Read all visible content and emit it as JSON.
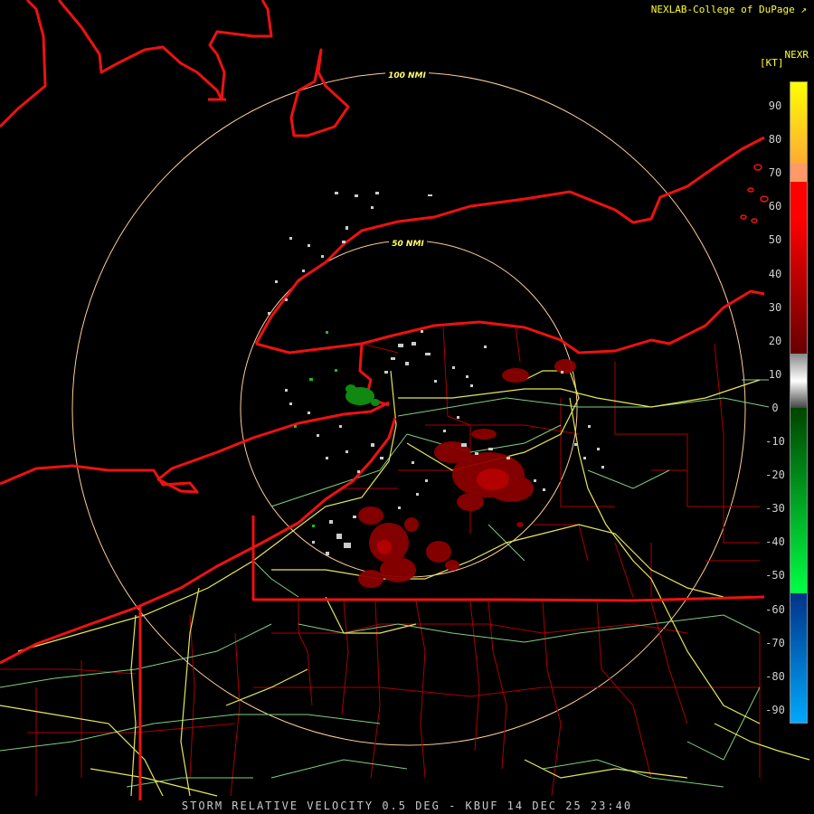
{
  "header": {
    "credit": "NEXLAB-College of DuPage",
    "credit_icon": "external-link-icon",
    "product": "NEXR",
    "unit": "[KT]"
  },
  "rings": {
    "inner_label": "50 NMI",
    "outer_label": "100 NMI"
  },
  "legend": {
    "ticks": [
      "90",
      "80",
      "70",
      "60",
      "50",
      "40",
      "30",
      "20",
      "10",
      "0",
      "-10",
      "-20",
      "-30",
      "-40",
      "-50",
      "-60",
      "-70",
      "-80",
      "-90"
    ],
    "colors": {
      "high": "#ffff00",
      "orange": "#ff9966",
      "red": "#ff0000",
      "dark_red": "#660000",
      "gray": "#999999",
      "green_dark": "#005500",
      "green_bright": "#00ff44",
      "blue": "#0066ff",
      "cyan": "#00aaff"
    }
  },
  "map_colors": {
    "coast_and_borders": "#ee1111",
    "county_lines": "#aa0000",
    "interstates": "#e6e65a",
    "highways": "#7fcf7f",
    "range_rings": "#ffcc99"
  },
  "footer": {
    "caption": "STORM RELATIVE VELOCITY 0.5 DEG - KBUF 14 DEC 25 23:40"
  }
}
